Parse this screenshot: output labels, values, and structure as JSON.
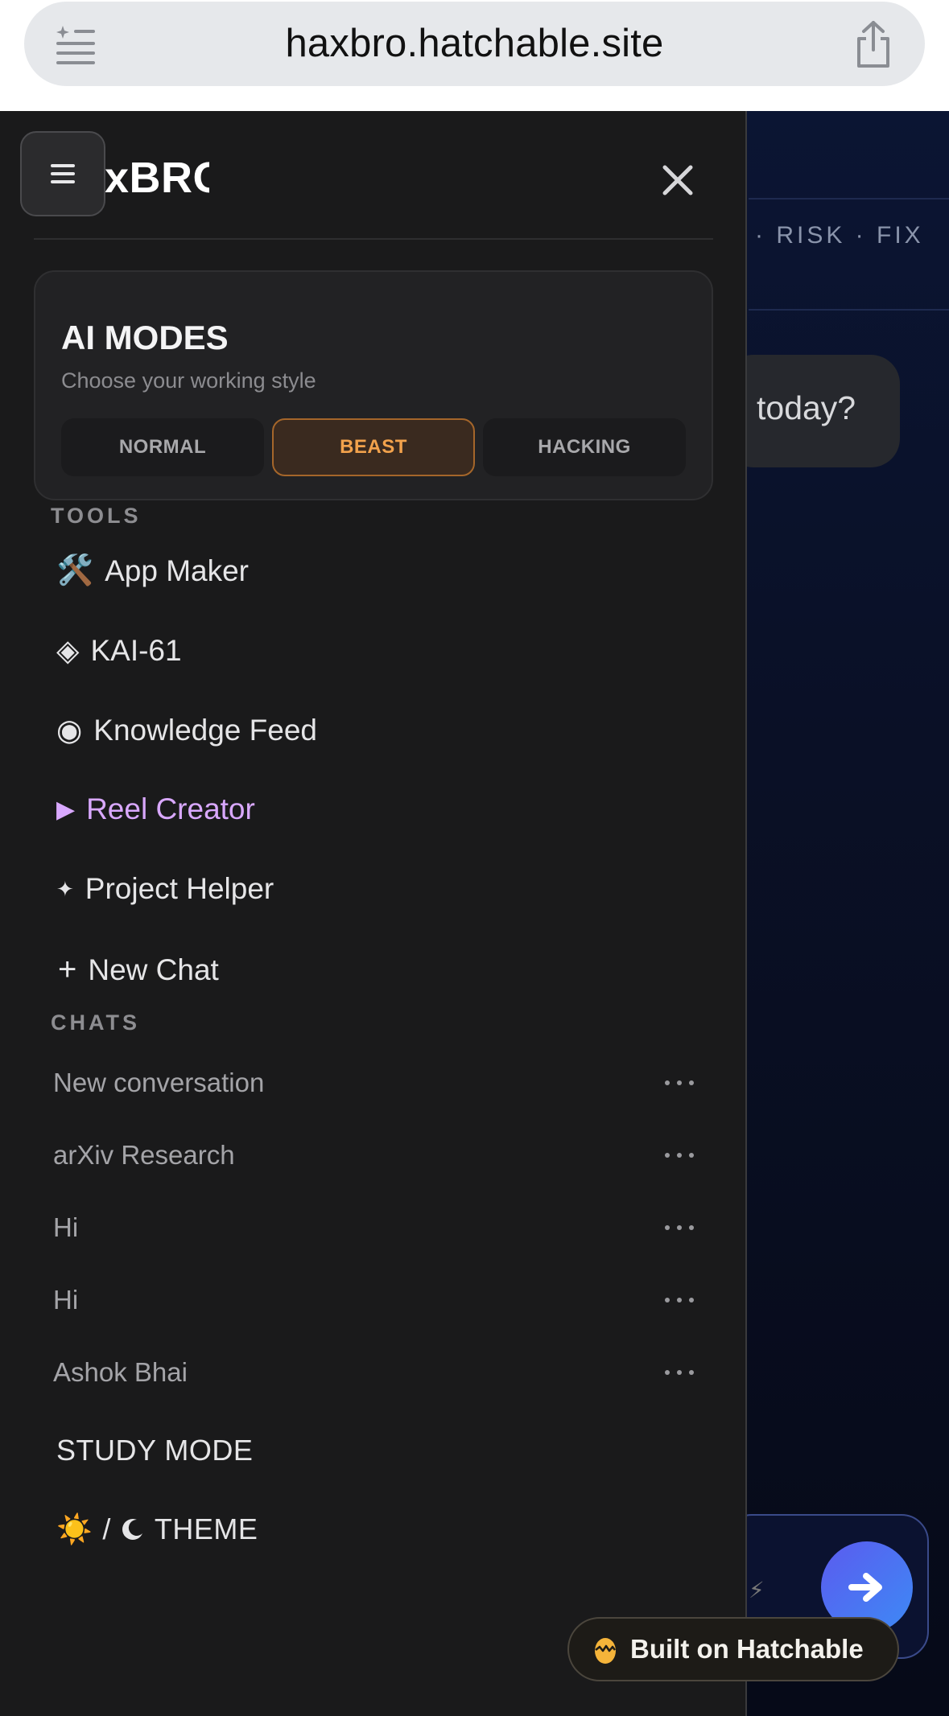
{
  "browser": {
    "url": "haxbro.hatchable.site"
  },
  "background": {
    "tagline": "· RISK · FIX",
    "bubble_text": "today?"
  },
  "drawer": {
    "brand": "HaxBRO",
    "ai_modes": {
      "title": "AI MODES",
      "subtitle": "Choose your working style",
      "options": [
        "NORMAL",
        "BEAST",
        "HACKING"
      ],
      "selected": "BEAST"
    },
    "tools_label": "TOOLS",
    "tools": [
      {
        "icon": "🛠️",
        "label": "App Maker"
      },
      {
        "icon": "◈",
        "label": "KAI-61"
      },
      {
        "icon": "◉",
        "label": "Knowledge Feed"
      },
      {
        "icon": "▶",
        "label": "Reel Creator"
      },
      {
        "icon": "✦",
        "label": "Project Helper"
      },
      {
        "icon": "+",
        "label": "New Chat"
      }
    ],
    "chats_label": "CHATS",
    "chats": [
      "New conversation",
      "arXiv Research",
      "Hi",
      "Hi",
      "Ashok Bhai"
    ],
    "study_mode": "STUDY MODE",
    "theme": {
      "sun": "☀️",
      "separator": "/",
      "label": "THEME"
    }
  },
  "badge": {
    "text": "Built on Hatchable"
  },
  "colors": {
    "accent_beast": "#f2a24c",
    "accent_reel": "#d9a8ff",
    "drawer_bg": "#1a1a1b"
  }
}
